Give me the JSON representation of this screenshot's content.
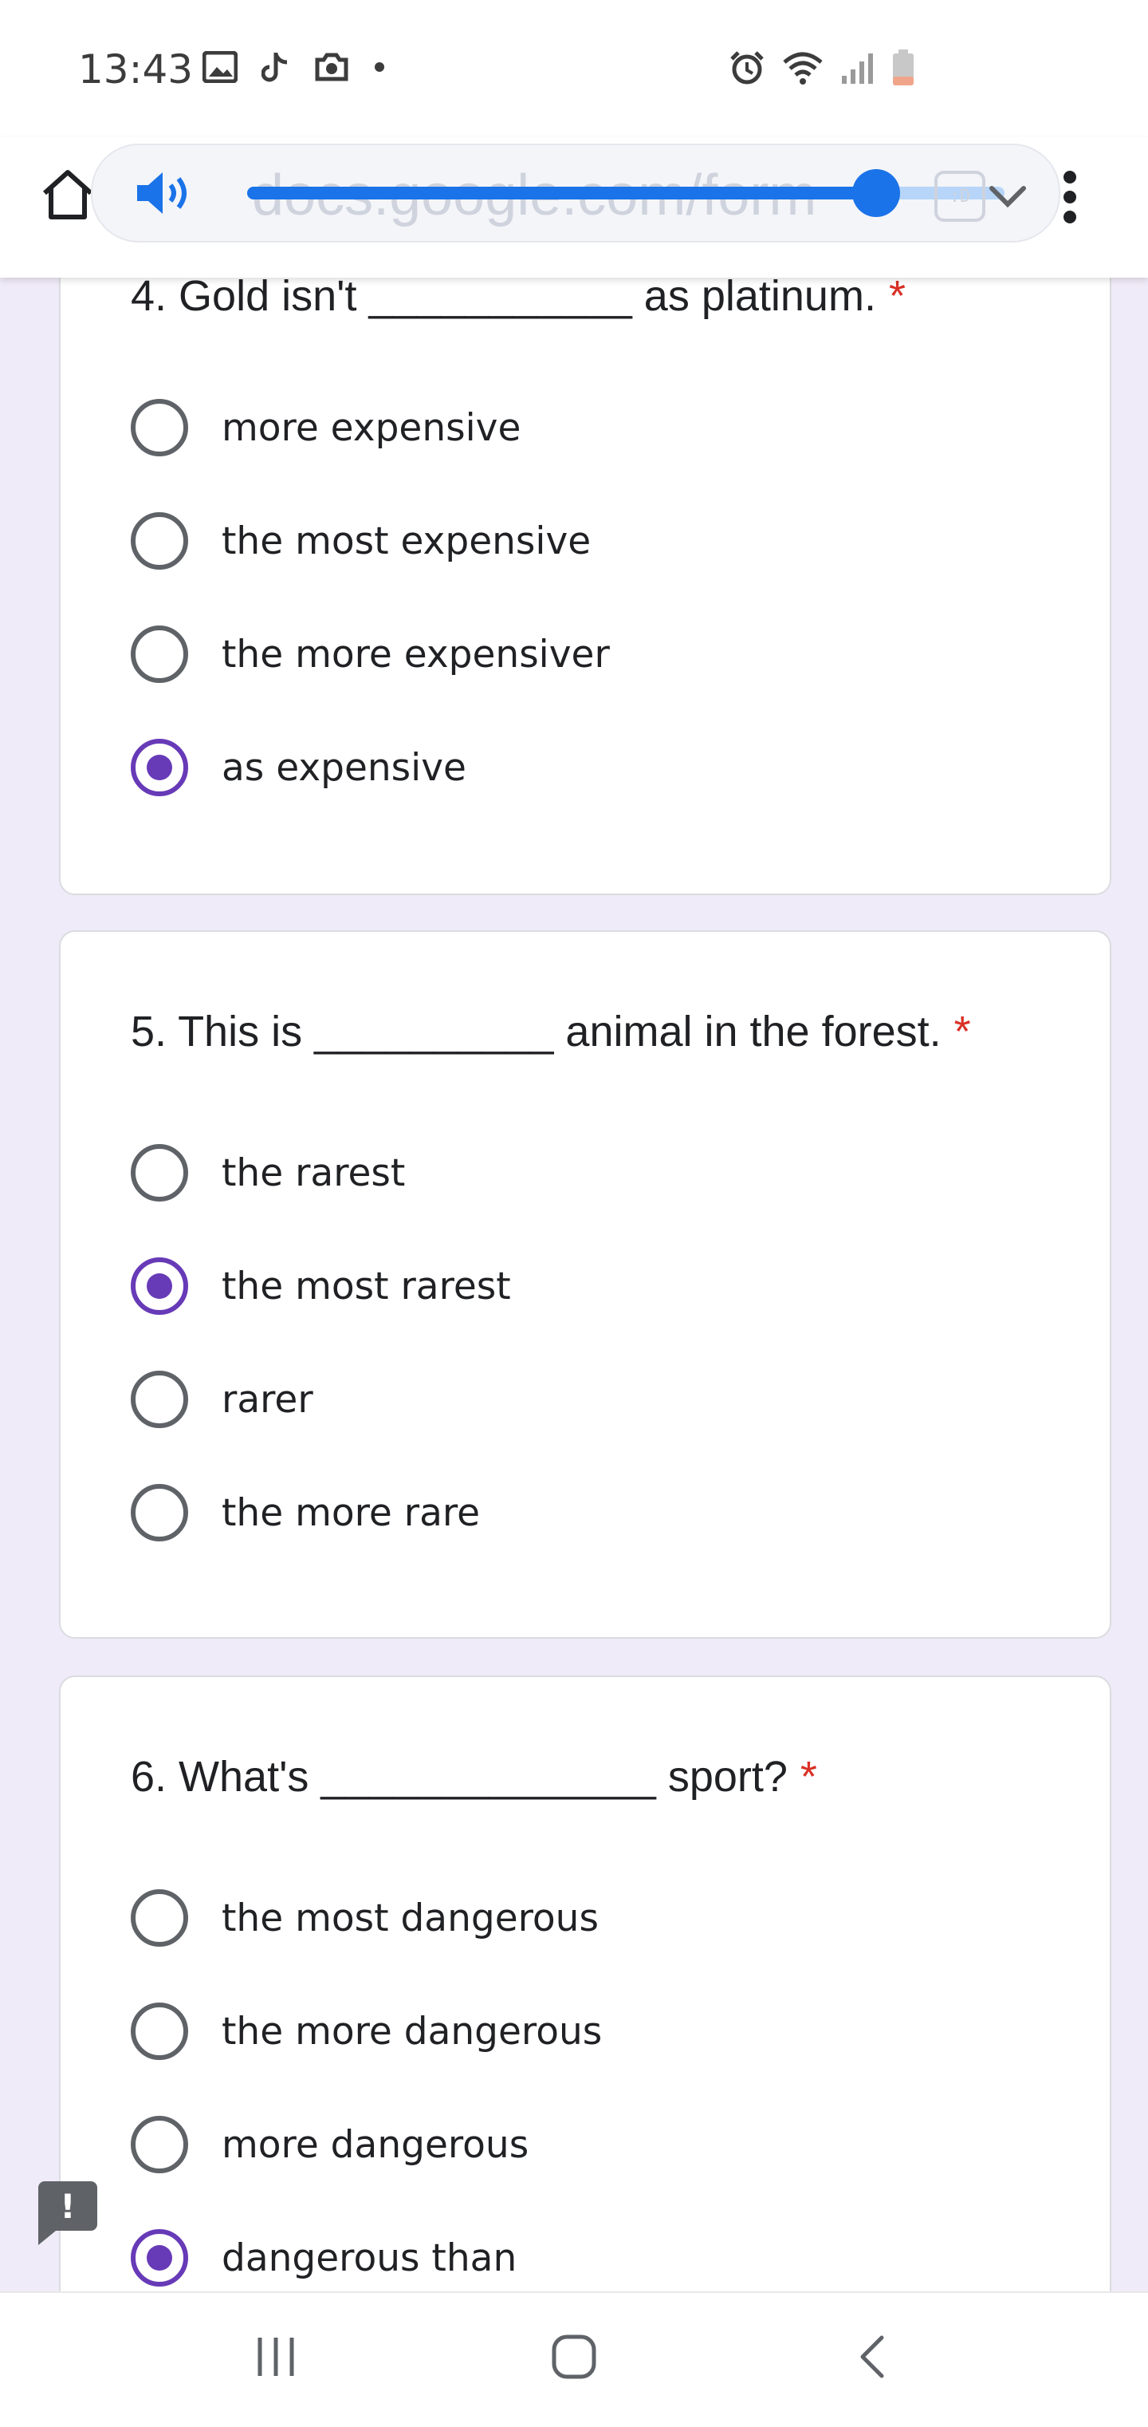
{
  "status_bar": {
    "time": "13:43",
    "icons_left": [
      "image-icon",
      "tiktok-icon",
      "camera-icon",
      "dot-icon"
    ],
    "icons_right": [
      "alarm-icon",
      "wifi-icon",
      "signal-icon",
      "battery-icon"
    ]
  },
  "browser": {
    "url": "docs.google.com/form",
    "tab_switcher": ":D",
    "volume_level": 0.83
  },
  "questions": [
    {
      "title": "4. Gold isn't ___________ as platinum.",
      "required_mark": "*",
      "options": [
        {
          "label": "more expensive",
          "selected": false
        },
        {
          "label": "the most expensive",
          "selected": false
        },
        {
          "label": "the more expensiver",
          "selected": false
        },
        {
          "label": "as expensive",
          "selected": true
        }
      ]
    },
    {
      "title": "5. This is __________ animal in the forest.",
      "required_mark": "*",
      "options": [
        {
          "label": "the rarest",
          "selected": false
        },
        {
          "label": "the most rarest",
          "selected": true
        },
        {
          "label": "rarer",
          "selected": false
        },
        {
          "label": "the more rare",
          "selected": false
        }
      ]
    },
    {
      "title": "6. What's ______________ sport?",
      "required_mark": "*",
      "options": [
        {
          "label": "the most dangerous",
          "selected": false
        },
        {
          "label": "the more dangerous",
          "selected": false
        },
        {
          "label": "more dangerous",
          "selected": false
        },
        {
          "label": "dangerous than",
          "selected": true
        }
      ]
    }
  ],
  "feedback": {
    "label": "!"
  },
  "colors": {
    "background": "#f0ebf8",
    "accent": "#673ab7",
    "required": "#d93025",
    "slider": "#1a73e8"
  }
}
